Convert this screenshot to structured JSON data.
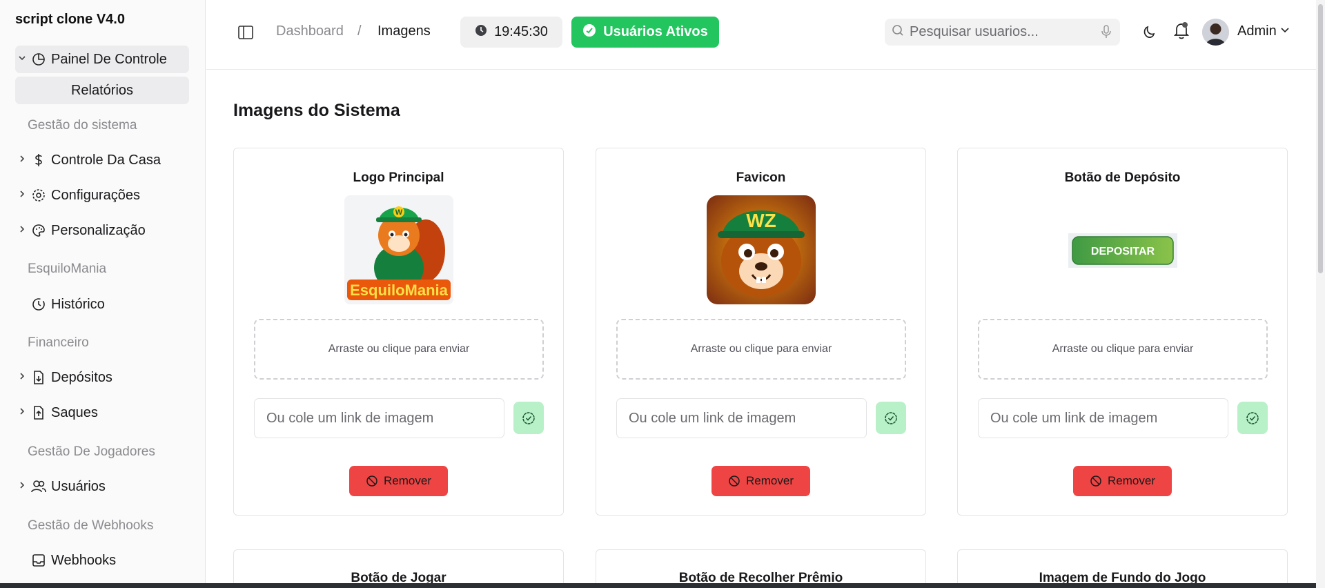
{
  "sidebar": {
    "brand": "script clone V4.0",
    "control_panel": "Painel De Controle",
    "reports": "Relatórios",
    "sections": {
      "system": "Gestão do sistema",
      "game": "EsquiloMania",
      "finance": "Financeiro",
      "players": "Gestão De Jogadores",
      "webhooks": "Gestão de Webhooks"
    },
    "items": {
      "house_control": "Controle Da Casa",
      "settings": "Configurações",
      "customization": "Personalização",
      "history": "Histórico",
      "deposits": "Depósitos",
      "withdrawals": "Saques",
      "users": "Usuários",
      "webhooks": "Webhooks"
    }
  },
  "header": {
    "breadcrumb_root": "Dashboard",
    "breadcrumb_sep": "/",
    "breadcrumb_current": "Imagens",
    "clock": "19:45:30",
    "active_users_label": "Usuários Ativos",
    "search_placeholder": "Pesquisar usuarios...",
    "user_name": "Admin"
  },
  "main": {
    "title": "Imagens do Sistema",
    "cards": [
      {
        "title": "Logo Principal",
        "logo_text": "EsquiloMania",
        "cap_letter": "W"
      },
      {
        "title": "Favicon",
        "cap_letters": "WZ"
      },
      {
        "title": "Botão de Depósito",
        "button_text": "DEPOSITAR"
      }
    ],
    "drop_label": "Arraste ou clique para enviar",
    "link_placeholder": "Ou cole um link de imagem",
    "remove_label": "Remover",
    "next_cards": [
      "Botão de Jogar",
      "Botão de Recolher Prêmio",
      "Imagem de Fundo do Jogo"
    ]
  },
  "colors": {
    "accent_green": "#22c55e",
    "confirm_bg": "#b8f0c8",
    "danger": "#ef4444"
  }
}
